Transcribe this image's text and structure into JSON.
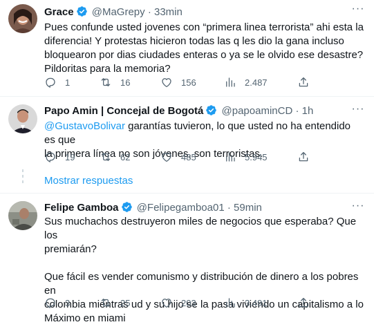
{
  "tweets": [
    {
      "name": "Grace",
      "handle": "@MaGrepy",
      "separator": "·",
      "time": "33min",
      "more": "···",
      "lines": [
        "Pues confunde usted jovenes con “primera linea terrorista” ahi esta la",
        "diferencia! Y protestas hicieron todas las q les dio la gana incluso",
        "bloquearon por dias ciudades enteras o ya se le olvido ese desastre?",
        "Pildoritas para la memoria?"
      ],
      "replies": "1",
      "retweets": "16",
      "likes": "156",
      "views": "2.487"
    },
    {
      "name": "Papo Amin | Concejal de Bogotá",
      "handle": "@papoaminCD",
      "separator": "·",
      "time": "1h",
      "more": "···",
      "mention": "@GustavoBolivar",
      "line1_rest": " garantías tuvieron, lo que usted no ha entendido es que",
      "line2": "la primera línea no son jóvenes, son terroristas.",
      "replies": "19",
      "retweets": "62",
      "likes": "485",
      "views": "5.945",
      "show_replies": "Mostrar respuestas"
    },
    {
      "name": "Felipe Gamboa",
      "handle": "@Felipegamboa01",
      "separator": "·",
      "time": "59min",
      "more": "···",
      "lines": [
        "Sus muchachos destruyeron miles de negocios que esperaba? Que los",
        "premiarán?",
        "",
        "Que fácil es vender comunismo y distribución de dinero a los pobres en",
        "colombia mientras ud y su hijo se la pasa viviendo un capitalismo a lo",
        "Máximo en miami"
      ],
      "replies": "3",
      "retweets": "25",
      "likes": "203",
      "views": "3.491"
    }
  ],
  "colors": {
    "accent": "#1d9bf0",
    "muted": "#536471",
    "text": "#0f1419",
    "border": "#eff3f4"
  },
  "icons": [
    "verified-badge-icon",
    "reply-icon",
    "retweet-icon",
    "like-icon",
    "views-icon",
    "share-icon",
    "more-icon"
  ]
}
